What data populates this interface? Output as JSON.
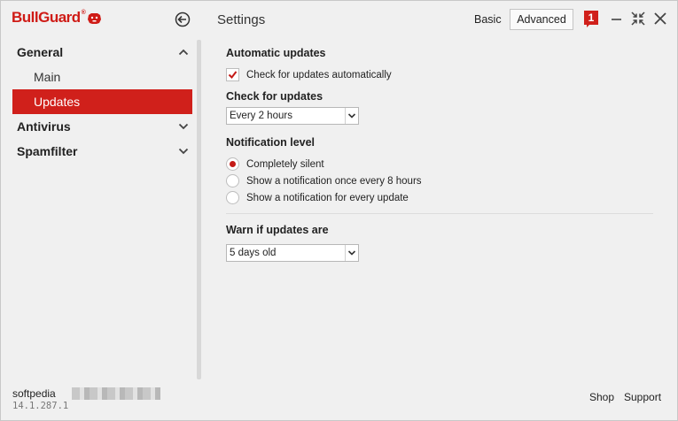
{
  "app": {
    "brand": "BullGuard",
    "brand_reg": "®",
    "title": "Settings",
    "brand_color": "#cf1b16"
  },
  "toolbar": {
    "basic_label": "Basic",
    "advanced_label": "Advanced",
    "notification_count": "1"
  },
  "sidebar": {
    "sections": [
      {
        "label": "General",
        "expanded": true,
        "items": [
          {
            "label": "Main",
            "active": false
          },
          {
            "label": "Updates",
            "active": true
          }
        ]
      },
      {
        "label": "Antivirus",
        "expanded": false
      },
      {
        "label": "Spamfilter",
        "expanded": false
      }
    ]
  },
  "content": {
    "automatic_updates": {
      "heading": "Automatic updates",
      "checkbox_label": "Check for updates automatically",
      "checked": true
    },
    "check_for_updates": {
      "heading": "Check for updates",
      "selected": "Every 2 hours"
    },
    "notification_level": {
      "heading": "Notification level",
      "options": [
        {
          "label": "Completely silent",
          "selected": true
        },
        {
          "label": "Show a notification once every 8 hours",
          "selected": false
        },
        {
          "label": "Show a notification for every update",
          "selected": false
        }
      ]
    },
    "warn_if_updates": {
      "heading": "Warn if updates are",
      "selected": "5 days old"
    }
  },
  "footer": {
    "user": "softpedia",
    "version": "14.1.287.1",
    "shop_label": "Shop",
    "support_label": "Support"
  }
}
